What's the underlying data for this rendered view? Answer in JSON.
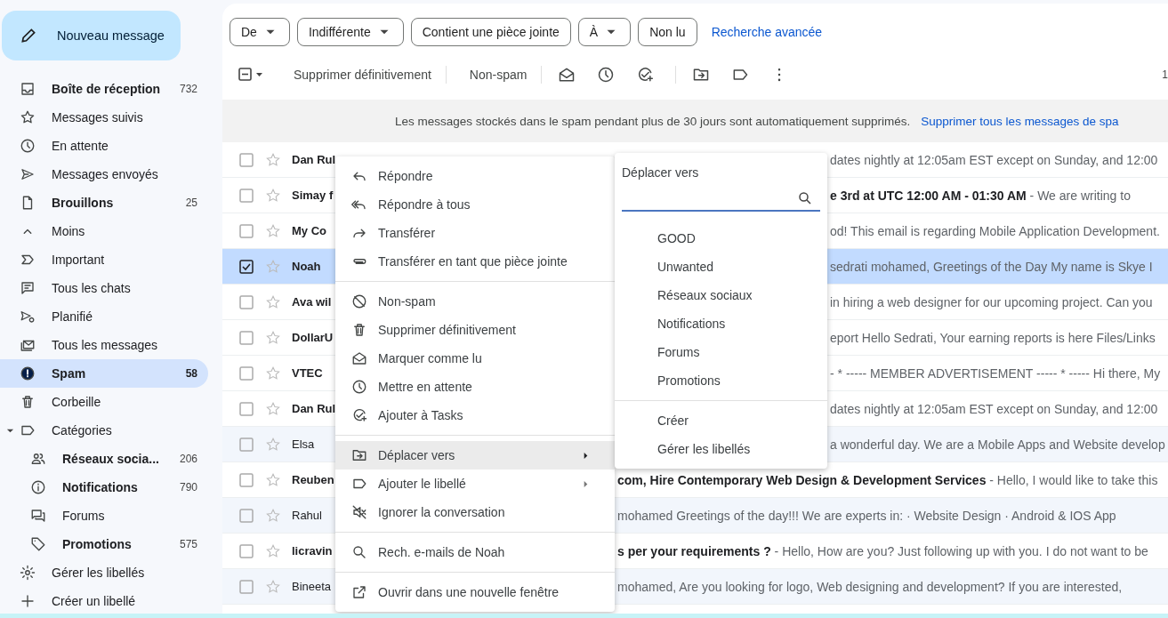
{
  "compose_button": {
    "label": "Nouveau message"
  },
  "sidebar": {
    "items": [
      {
        "label": "Boîte de réception",
        "count": "732",
        "unread": true,
        "selected": false
      },
      {
        "label": "Messages suivis",
        "unread": false,
        "selected": false
      },
      {
        "label": "En attente",
        "unread": false,
        "selected": false
      },
      {
        "label": "Messages envoyés",
        "unread": false,
        "selected": false
      },
      {
        "label": "Brouillons",
        "count": "25",
        "unread": true,
        "selected": false
      },
      {
        "label": "Moins",
        "unread": false,
        "selected": false
      },
      {
        "label": "Important",
        "unread": false,
        "selected": false
      },
      {
        "label": "Tous les chats",
        "unread": false,
        "selected": false
      },
      {
        "label": "Planifié",
        "unread": false,
        "selected": false
      },
      {
        "label": "Tous les messages",
        "unread": false,
        "selected": false
      },
      {
        "label": "Spam",
        "count": "58",
        "unread": true,
        "selected": true
      },
      {
        "label": "Corbeille",
        "unread": false,
        "selected": false
      },
      {
        "label": "Catégories",
        "unread": false,
        "selected": false,
        "expanded": true,
        "children": [
          {
            "label": "Réseaux socia...",
            "count": "206",
            "unread": true,
            "selected": false
          },
          {
            "label": "Notifications",
            "count": "790",
            "unread": true,
            "selected": false
          },
          {
            "label": "Forums",
            "unread": false,
            "selected": false
          },
          {
            "label": "Promotions",
            "count": "575",
            "unread": true,
            "selected": false
          }
        ]
      },
      {
        "label": "Gérer les libellés",
        "unread": false,
        "selected": false
      },
      {
        "label": "Créer un libellé",
        "unread": false,
        "selected": false
      }
    ]
  },
  "filters": [
    {
      "label": "De",
      "dropdown": true
    },
    {
      "label": "Indifférente",
      "dropdown": true
    },
    {
      "label": "Contient une pièce jointe",
      "dropdown": false
    },
    {
      "label": "À",
      "dropdown": true
    },
    {
      "label": "Non lu",
      "dropdown": false
    }
  ],
  "advanced_search_link": "Recherche avancée",
  "toolbar": {
    "select_all_partial": true,
    "actions": [
      "Supprimer définitivement",
      "Non-spam"
    ],
    "page_info": "1"
  },
  "banner": {
    "text": "Les messages stockés dans le spam pendant plus de 30 jours sont automatiquement supprimés.",
    "link": "Supprimer tous les messages de spa"
  },
  "emails": [
    {
      "sender": "Dan Rul",
      "snippet": "dates nightly at 12:05am EST except on Sunday, and 12:00",
      "checked": false,
      "starred": false,
      "unread": true
    },
    {
      "sender": "Simay f",
      "snippet": "**e 3rd at UTC 12:00 AM - 01:30 AM** - We are writing to",
      "checked": false,
      "starred": false,
      "unread": true
    },
    {
      "sender": "My Co",
      "snippet": "od! This email is regarding Mobile Application Development.",
      "checked": false,
      "starred": false,
      "unread": true
    },
    {
      "sender": "Noah",
      "snippet": "sedrati mohamed, Greetings of the Day My name is Skye I",
      "checked": true,
      "starred": false,
      "unread": true
    },
    {
      "sender": "Ava wil",
      "snippet": "in hiring a web designer for our upcoming project. Can you",
      "checked": false,
      "starred": false,
      "unread": true
    },
    {
      "sender": "DollarU",
      "snippet": "eport Hello Sedrati, Your earning reports is here Files/Links",
      "checked": false,
      "starred": false,
      "unread": true
    },
    {
      "sender": "VTEC",
      "snippet": "- * ----- MEMBER ADVERTISEMENT ----- * ----- Hi there, My",
      "checked": false,
      "starred": false,
      "unread": true
    },
    {
      "sender": "Dan Rul",
      "snippet": "dates nightly at 12:05am EST except on Sunday, and 12:00",
      "checked": false,
      "starred": false,
      "unread": true
    },
    {
      "sender": "Elsa",
      "snippet": "a wonderful day. We are a Mobile Apps and Website develop",
      "checked": false,
      "starred": false,
      "unread": false
    },
    {
      "sender": "Reuben",
      "snippet": "**com, Hire Contemporary Web Design & Development Services** - Hello, I would like to take this",
      "checked": false,
      "starred": false,
      "unread": true
    },
    {
      "sender": "Rahul",
      "snippet": "mohamed Greetings of the day!!! We are experts in: · Website Design · Android & IOS App",
      "checked": false,
      "starred": false,
      "unread": false
    },
    {
      "sender": "licravin",
      "snippet": "**s per your requirements ?** - Hello, How are you? Just following up with you. I do not want to be",
      "checked": false,
      "starred": false,
      "unread": true
    },
    {
      "sender": "Bineeta",
      "snippet": "mohamed, Are you looking for logo, Web designing and development? If you are interested,",
      "checked": false,
      "starred": false,
      "unread": false
    }
  ],
  "context_menu": {
    "groups": [
      [
        {
          "label": "Répondre",
          "submenu": false,
          "selected": false
        },
        {
          "label": "Répondre à tous",
          "submenu": false,
          "selected": false
        },
        {
          "label": "Transférer",
          "submenu": false,
          "selected": false
        },
        {
          "label": "Transférer en tant que pièce jointe",
          "submenu": false,
          "selected": false
        }
      ],
      [
        {
          "label": "Non-spam",
          "submenu": false,
          "selected": false
        },
        {
          "label": "Supprimer définitivement",
          "submenu": false,
          "selected": false
        },
        {
          "label": "Marquer comme lu",
          "submenu": false,
          "selected": false
        },
        {
          "label": "Mettre en attente",
          "submenu": false,
          "selected": false
        },
        {
          "label": "Ajouter à Tasks",
          "submenu": false,
          "selected": false
        }
      ],
      [
        {
          "label": "Déplacer vers",
          "submenu": true,
          "selected": true
        },
        {
          "label": "Ajouter le libellé",
          "submenu": true,
          "selected": false
        },
        {
          "label": "Ignorer la conversation",
          "submenu": false,
          "selected": false
        }
      ],
      [
        {
          "label": "Rech. e-mails de Noah",
          "submenu": false,
          "selected": false
        }
      ],
      [
        {
          "label": "Ouvrir dans une nouvelle fenêtre",
          "submenu": false,
          "selected": false
        }
      ]
    ]
  },
  "move_to_menu": {
    "title": "Déplacer vers",
    "groups": [
      [
        "GOOD",
        "Unwanted",
        "Réseaux sociaux",
        "Notifications",
        "Forums",
        "Promotions"
      ],
      [
        "Créer",
        "Gérer les libellés"
      ]
    ]
  }
}
